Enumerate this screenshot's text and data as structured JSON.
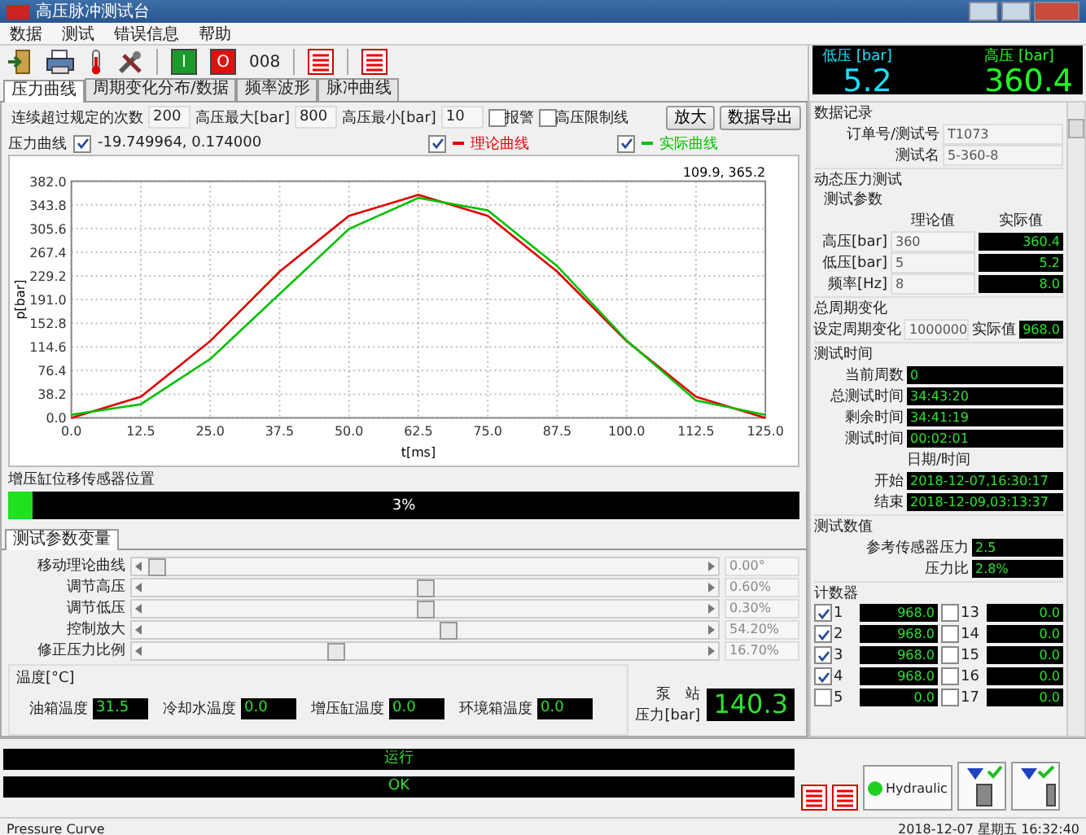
{
  "window": {
    "title": "高压脉冲测试台"
  },
  "menu": [
    {
      "label": "数据"
    },
    {
      "label": "测试"
    },
    {
      "label": "错误信息"
    },
    {
      "label": "帮助"
    }
  ],
  "toolbar": {
    "start": "I",
    "stop": "O",
    "counter": "008"
  },
  "tabs": [
    {
      "label": "压力曲线",
      "selected": true
    },
    {
      "label": "周期变化分布/数据",
      "selected": false
    },
    {
      "label": "频率波形",
      "selected": false
    },
    {
      "label": "脉冲曲线",
      "selected": false
    }
  ],
  "settings": {
    "fields": [
      {
        "label": "连续超过规定的次数",
        "value": "200"
      },
      {
        "label": "高压最大[bar]",
        "value": "800"
      },
      {
        "label": "高压最小[bar]",
        "value": "10"
      }
    ],
    "checkboxes": [
      {
        "label": "报警",
        "checked": false
      },
      {
        "label": "高压限制线",
        "checked": false
      }
    ],
    "buttons": [
      {
        "label": "放大"
      },
      {
        "label": "数据导出"
      }
    ]
  },
  "chart_panel": {
    "title": "压力曲线",
    "cursor": {
      "label": "-19.749964, 0.174000",
      "checked": true
    },
    "legend": [
      {
        "checked": true
      },
      {
        "checked": true
      }
    ],
    "chart_data": {
      "type": "line",
      "grid": true,
      "xlabel": "t[ms]",
      "ylabel": "p[bar]",
      "x": [
        0,
        12.5,
        25,
        37.5,
        50,
        62.5,
        75,
        87.5,
        100,
        112.5,
        125
      ],
      "series": [
        {
          "name": "理论曲线",
          "color": "#e00000",
          "values": [
            0,
            34,
            124,
            236,
            326,
            360,
            326,
            236,
            124,
            34,
            0
          ]
        },
        {
          "name": "实际曲线",
          "color": "#00c000",
          "values": [
            5,
            22,
            95,
            200,
            305,
            355,
            335,
            245,
            125,
            28,
            5
          ]
        }
      ],
      "xlim": [
        0,
        125
      ],
      "ylim": [
        0,
        382
      ],
      "xticks": [
        {
          "value": 0,
          "label": "0.0"
        },
        {
          "value": 12.5,
          "label": "12.5"
        },
        {
          "value": 25,
          "label": "25.0"
        },
        {
          "value": 37.5,
          "label": "37.5"
        },
        {
          "value": 50,
          "label": "50.0"
        },
        {
          "value": 62.5,
          "label": "62.5"
        },
        {
          "value": 75,
          "label": "75.0"
        },
        {
          "value": 87.5,
          "label": "87.5"
        },
        {
          "value": 100,
          "label": "100.0"
        },
        {
          "value": 112.5,
          "label": "112.5"
        },
        {
          "value": 125,
          "label": "125.0"
        }
      ],
      "yticks": [
        {
          "value": 0,
          "label": "0.0"
        },
        {
          "value": 38.2,
          "label": "38.2"
        },
        {
          "value": 76.4,
          "label": "76.4"
        },
        {
          "value": 114.6,
          "label": "114.6"
        },
        {
          "value": 152.8,
          "label": "152.8"
        },
        {
          "value": 191,
          "label": "191.0"
        },
        {
          "value": 229.2,
          "label": "229.2"
        },
        {
          "value": 267.4,
          "label": "267.4"
        },
        {
          "value": 305.6,
          "label": "305.6"
        },
        {
          "value": 343.8,
          "label": "343.8"
        },
        {
          "value": 382,
          "label": "382.0"
        }
      ],
      "annotations": [
        "109.9, 365.2"
      ]
    }
  },
  "sensor": {
    "label": "增压缸位移传感器位置",
    "level": 0.03,
    "reading": "3%"
  },
  "param_tabs": [
    {
      "label": "测试参数变量",
      "selected": true
    }
  ],
  "sliders": [
    {
      "label": "移动理论曲线",
      "level": 0.02,
      "reading": "0.00°"
    },
    {
      "label": "调节高压",
      "level": 0.5,
      "reading": "0.60%"
    },
    {
      "label": "调节低压",
      "level": 0.5,
      "reading": "0.30%"
    },
    {
      "label": "控制放大",
      "level": 0.54,
      "reading": "54.20%"
    },
    {
      "label": "修正压力比例",
      "level": 0.34,
      "reading": "16.70%"
    }
  ],
  "temperature": {
    "title": "温度[°C]",
    "readings": [
      {
        "label": "油箱温度",
        "value": "31.5"
      },
      {
        "label": "冷却水温度",
        "value": "0.0"
      },
      {
        "label": "增压缸温度",
        "value": "0.0"
      },
      {
        "label": "环境箱温度",
        "value": "0.0"
      }
    ],
    "pump": {
      "label_1": "泵　站",
      "label_2": "压力[bar]",
      "value": "140.3"
    }
  },
  "run_status": [
    {
      "text": "运行"
    },
    {
      "text": "OK"
    }
  ],
  "gauges": [
    {
      "label": "低压",
      "unit": "[bar]",
      "value": "5.2",
      "color": "#18e0ff"
    },
    {
      "label": "高压",
      "unit": "[bar]",
      "value": "360.4",
      "color": "#20ff20"
    }
  ],
  "data_record": {
    "title": "数据记录",
    "rows": [
      {
        "label": "订单号/测试号",
        "value": "T1073"
      },
      {
        "label": "测试名",
        "value": "5-360-8"
      }
    ]
  },
  "dynamic_test": {
    "title": "动态压力测试",
    "subtitle": "测试参数",
    "headers": [
      "理论值",
      "实际值"
    ],
    "rows": [
      {
        "label": "高压[bar]",
        "nominal": "360",
        "actual": "360.4"
      },
      {
        "label": "低压[bar]",
        "nominal": "5",
        "actual": "5.2"
      },
      {
        "label": "频率[Hz]",
        "nominal": "8",
        "actual": "8.0"
      }
    ]
  },
  "cycle_change": {
    "title": "总周期变化",
    "label": "设定周期变化",
    "value": "1000000",
    "actual_label": "实际值",
    "actual": "968.0"
  },
  "test_time": {
    "title": "测试时间",
    "rows": [
      {
        "label": "当前周数",
        "value": "0"
      },
      {
        "label": "总测试时间",
        "value": "34:43:20"
      },
      {
        "label": "剩余时间",
        "value": "34:41:19"
      },
      {
        "label": "测试时间",
        "value": "00:02:01"
      }
    ],
    "date_heading": "日期/时间",
    "dates": [
      {
        "label": "开始",
        "value": "2018-12-07,16:30:17"
      },
      {
        "label": "结束",
        "value": "2018-12-09,03:13:37"
      }
    ]
  },
  "test_values": {
    "title": "测试数值",
    "rows": [
      {
        "label": "参考传感器压力",
        "value": "2.5"
      },
      {
        "label": "压力比",
        "value": "2.8%"
      }
    ]
  },
  "counters": {
    "title": "计数器",
    "items": [
      {
        "label": "1",
        "checked": true,
        "value": "968.0"
      },
      {
        "label": "13",
        "checked": false,
        "value": "0.0"
      },
      {
        "label": "2",
        "checked": true,
        "value": "968.0"
      },
      {
        "label": "14",
        "checked": false,
        "value": "0.0"
      },
      {
        "label": "3",
        "checked": true,
        "value": "968.0"
      },
      {
        "label": "15",
        "checked": false,
        "value": "0.0"
      },
      {
        "label": "4",
        "checked": true,
        "value": "968.0"
      },
      {
        "label": "16",
        "checked": false,
        "value": "0.0"
      },
      {
        "label": "5",
        "checked": false,
        "value": "0.0"
      },
      {
        "label": "17",
        "checked": false,
        "value": "0.0"
      }
    ]
  },
  "indicators": {
    "hydraulic": {
      "label": "Hydraulic",
      "on": true
    }
  },
  "status_bar": {
    "text": "Pressure Curve",
    "datetime": "2018-12-07 星期五 16:32:40"
  }
}
